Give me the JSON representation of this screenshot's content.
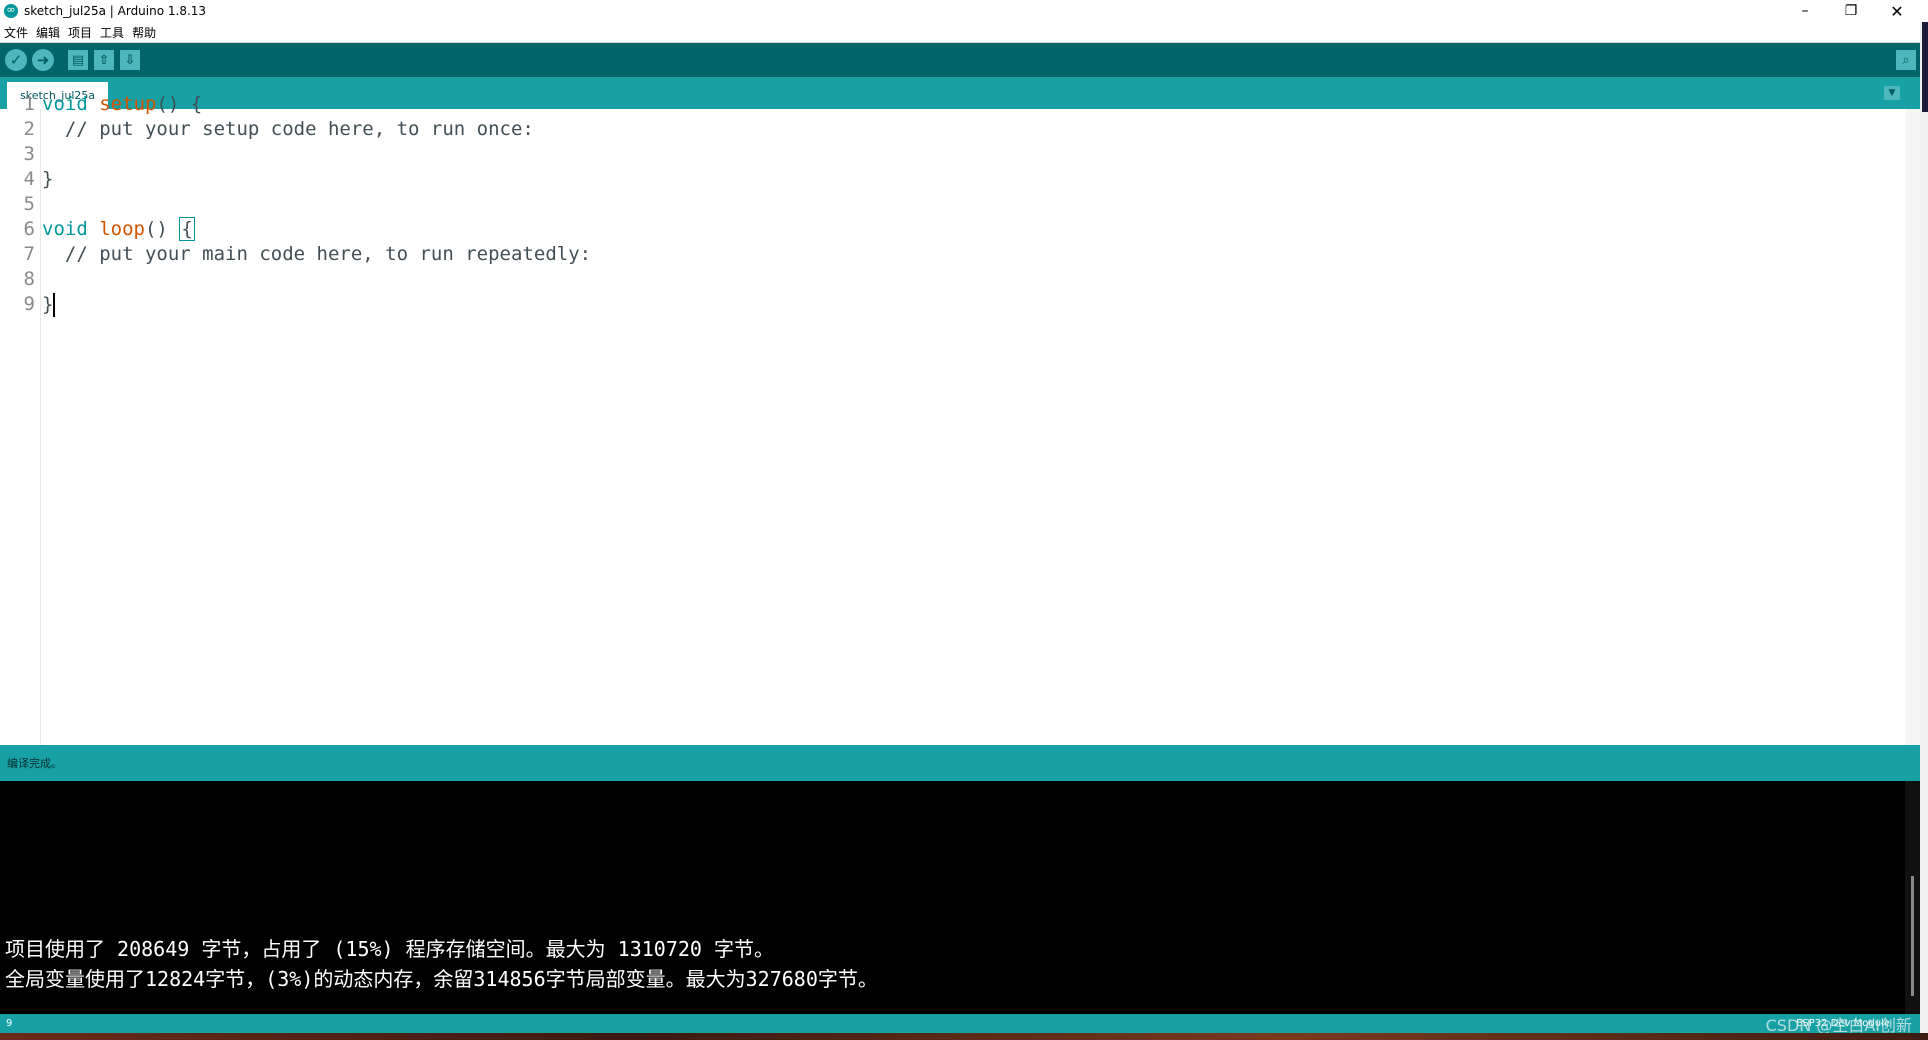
{
  "window": {
    "title": "sketch_jul25a | Arduino 1.8.13",
    "min_glyph": "–",
    "max_glyph": "❐",
    "close_glyph": "✕"
  },
  "menubar": [
    "文件",
    "编辑",
    "项目",
    "工具",
    "帮助"
  ],
  "toolbar": {
    "verify_icon": "✓",
    "upload_icon": "➜",
    "new_icon": "▤",
    "open_icon": "⇧",
    "save_icon": "⇩",
    "serial_icon": "⌕"
  },
  "tabs": {
    "active": "sketch_jul25a",
    "menu_glyph": "▼"
  },
  "editor": {
    "lines": [
      {
        "no": "1",
        "a": "void",
        "b": " ",
        "c": "setup",
        "d": "() {"
      },
      {
        "no": "2",
        "a": "",
        "b": "  // put your setup code here, to run once:",
        "c": "",
        "d": ""
      },
      {
        "no": "3",
        "a": "",
        "b": "",
        "c": "",
        "d": ""
      },
      {
        "no": "4",
        "a": "",
        "b": "}",
        "c": "",
        "d": ""
      },
      {
        "no": "5",
        "a": "",
        "b": "",
        "c": "",
        "d": ""
      },
      {
        "no": "6",
        "a": "void",
        "b": " ",
        "c": "loop",
        "d": "() "
      },
      {
        "no": "7",
        "a": "",
        "b": "  // put your main code here, to run repeatedly:",
        "c": "",
        "d": ""
      },
      {
        "no": "8",
        "a": "",
        "b": "",
        "c": "",
        "d": ""
      },
      {
        "no": "9",
        "a": "",
        "b": "}",
        "c": "",
        "d": ""
      }
    ],
    "loop_brace": "{"
  },
  "status": {
    "message": "编译完成。"
  },
  "console": {
    "line1": "项目使用了 208649 字节，占用了 (15%) 程序存储空间。最大为 1310720 字节。",
    "line2": "全局变量使用了12824字节，(3%)的动态内存，余留314856字节局部变量。最大为327680字节。"
  },
  "footer": {
    "line_number": "9",
    "board": "ESP32 Dev Module",
    "watermark": "CSDN @空白AI创新"
  }
}
